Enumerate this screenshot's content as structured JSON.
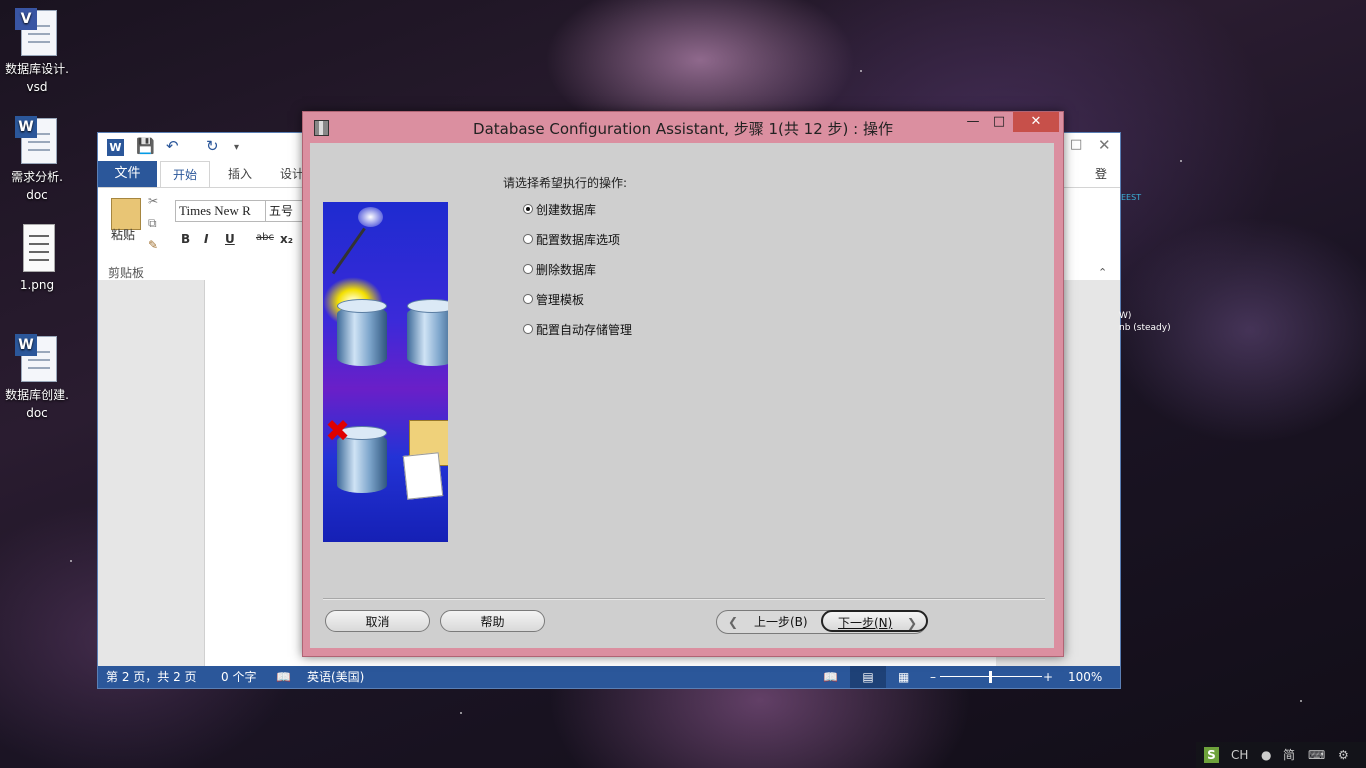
{
  "desktop": {
    "icons": [
      {
        "label": "数据库设计.\nvsd",
        "line1": "数据库设计.",
        "line2": "vsd"
      },
      {
        "label": "需求分析.\ndoc",
        "line1": "需求分析.",
        "line2": "doc"
      },
      {
        "label": "1.png",
        "line1": "1.png",
        "line2": ""
      },
      {
        "label": "数据库创建.\ndoc",
        "line1": "数据库创建.",
        "line2": "doc"
      }
    ]
  },
  "word": {
    "logo": "W",
    "tabs": {
      "file": "文件",
      "home": "开始",
      "insert": "插入",
      "design": "设计"
    },
    "signin": "登录",
    "ribbon": {
      "paste": "粘贴",
      "clipboard": "剪贴板",
      "font_name": "Times New R",
      "font_size": "五号",
      "bold": "B",
      "italic": "I",
      "underline": "U",
      "strike": "abc",
      "sub": "x₂"
    },
    "side_text": {
      "a": "EEST",
      "b": "W)",
      "c": "nb (steady)"
    },
    "status": {
      "page": "第 2 页，共 2 页",
      "words": "0 个字",
      "language": "英语(美国)",
      "zoom": "100%"
    }
  },
  "dialog": {
    "title": "Database Configuration Assistant, 步骤 1(共 12 步) : 操作",
    "prompt": "请选择希望执行的操作:",
    "options": [
      {
        "label": "创建数据库",
        "selected": true
      },
      {
        "label": "配置数据库选项",
        "selected": false
      },
      {
        "label": "删除数据库",
        "selected": false
      },
      {
        "label": "管理模板",
        "selected": false
      },
      {
        "label": "配置自动存储管理",
        "selected": false
      }
    ],
    "buttons": {
      "cancel": "取消",
      "help": "帮助",
      "back": "上一步(B)",
      "next": "下一步(N)"
    }
  },
  "tray": {
    "ime_badge": "S",
    "lang": "CH",
    "mode": "简"
  },
  "colors": {
    "word_blue": "#2b579a",
    "dialog_frame": "#db8fa0",
    "dialog_body": "#cfcfcf",
    "close_red": "#c7504a"
  }
}
